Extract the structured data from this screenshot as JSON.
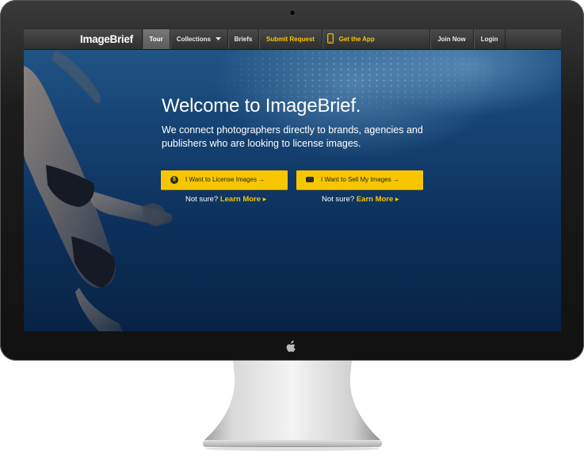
{
  "nav": {
    "logo": "ImageBrief",
    "items": [
      "Tour",
      "Collections",
      "Briefs",
      "Submit Request",
      "Get the App",
      "Join Now",
      "Login"
    ]
  },
  "hero": {
    "headline": "Welcome to ImageBrief.",
    "subline": "We connect photographers directly to brands, agencies and publishers who are looking to license images.",
    "cta_license": {
      "label": "I Want to License Images →",
      "icon": "dollar-icon"
    },
    "cta_sell": {
      "label": "I Want to Sell My Images →",
      "icon": "camera-icon"
    },
    "not_sure_prefix": "Not sure?",
    "learn_more": "Learn More ▸",
    "earn_more": "Earn More ▸"
  },
  "colors": {
    "accent": "#f7c600",
    "nav": "#3a3a3a",
    "hero": "#0d315c"
  }
}
